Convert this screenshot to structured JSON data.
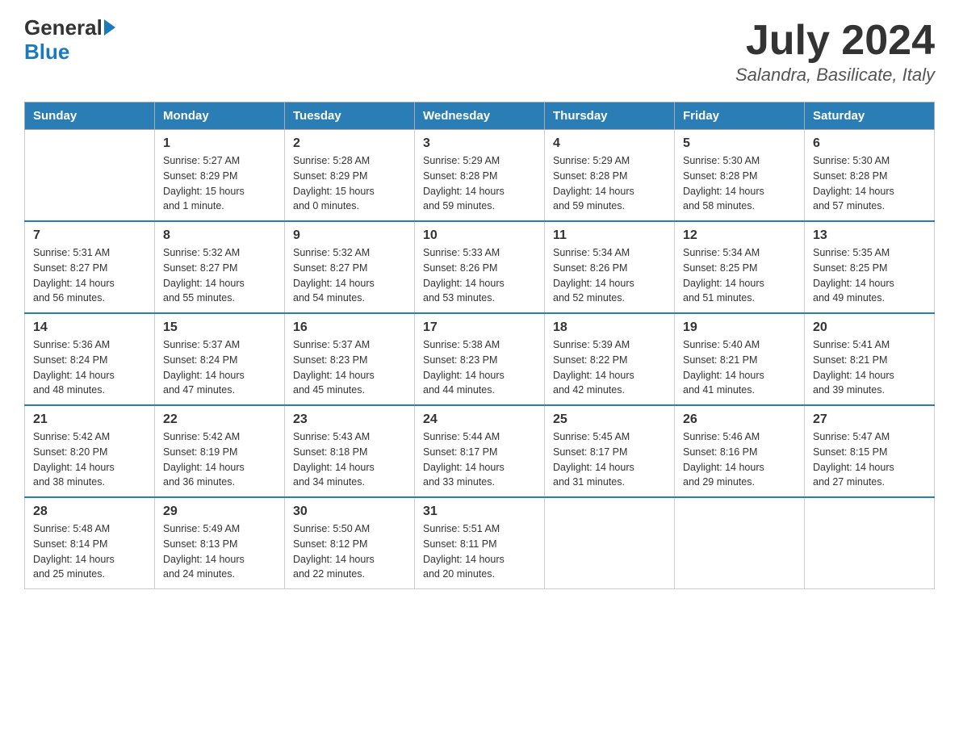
{
  "header": {
    "logo_text1": "General",
    "logo_text2": "Blue",
    "month_title": "July 2024",
    "location": "Salandra, Basilicate, Italy"
  },
  "weekdays": [
    "Sunday",
    "Monday",
    "Tuesday",
    "Wednesday",
    "Thursday",
    "Friday",
    "Saturday"
  ],
  "weeks": [
    [
      {
        "day": "",
        "info": ""
      },
      {
        "day": "1",
        "info": "Sunrise: 5:27 AM\nSunset: 8:29 PM\nDaylight: 15 hours\nand 1 minute."
      },
      {
        "day": "2",
        "info": "Sunrise: 5:28 AM\nSunset: 8:29 PM\nDaylight: 15 hours\nand 0 minutes."
      },
      {
        "day": "3",
        "info": "Sunrise: 5:29 AM\nSunset: 8:28 PM\nDaylight: 14 hours\nand 59 minutes."
      },
      {
        "day": "4",
        "info": "Sunrise: 5:29 AM\nSunset: 8:28 PM\nDaylight: 14 hours\nand 59 minutes."
      },
      {
        "day": "5",
        "info": "Sunrise: 5:30 AM\nSunset: 8:28 PM\nDaylight: 14 hours\nand 58 minutes."
      },
      {
        "day": "6",
        "info": "Sunrise: 5:30 AM\nSunset: 8:28 PM\nDaylight: 14 hours\nand 57 minutes."
      }
    ],
    [
      {
        "day": "7",
        "info": "Sunrise: 5:31 AM\nSunset: 8:27 PM\nDaylight: 14 hours\nand 56 minutes."
      },
      {
        "day": "8",
        "info": "Sunrise: 5:32 AM\nSunset: 8:27 PM\nDaylight: 14 hours\nand 55 minutes."
      },
      {
        "day": "9",
        "info": "Sunrise: 5:32 AM\nSunset: 8:27 PM\nDaylight: 14 hours\nand 54 minutes."
      },
      {
        "day": "10",
        "info": "Sunrise: 5:33 AM\nSunset: 8:26 PM\nDaylight: 14 hours\nand 53 minutes."
      },
      {
        "day": "11",
        "info": "Sunrise: 5:34 AM\nSunset: 8:26 PM\nDaylight: 14 hours\nand 52 minutes."
      },
      {
        "day": "12",
        "info": "Sunrise: 5:34 AM\nSunset: 8:25 PM\nDaylight: 14 hours\nand 51 minutes."
      },
      {
        "day": "13",
        "info": "Sunrise: 5:35 AM\nSunset: 8:25 PM\nDaylight: 14 hours\nand 49 minutes."
      }
    ],
    [
      {
        "day": "14",
        "info": "Sunrise: 5:36 AM\nSunset: 8:24 PM\nDaylight: 14 hours\nand 48 minutes."
      },
      {
        "day": "15",
        "info": "Sunrise: 5:37 AM\nSunset: 8:24 PM\nDaylight: 14 hours\nand 47 minutes."
      },
      {
        "day": "16",
        "info": "Sunrise: 5:37 AM\nSunset: 8:23 PM\nDaylight: 14 hours\nand 45 minutes."
      },
      {
        "day": "17",
        "info": "Sunrise: 5:38 AM\nSunset: 8:23 PM\nDaylight: 14 hours\nand 44 minutes."
      },
      {
        "day": "18",
        "info": "Sunrise: 5:39 AM\nSunset: 8:22 PM\nDaylight: 14 hours\nand 42 minutes."
      },
      {
        "day": "19",
        "info": "Sunrise: 5:40 AM\nSunset: 8:21 PM\nDaylight: 14 hours\nand 41 minutes."
      },
      {
        "day": "20",
        "info": "Sunrise: 5:41 AM\nSunset: 8:21 PM\nDaylight: 14 hours\nand 39 minutes."
      }
    ],
    [
      {
        "day": "21",
        "info": "Sunrise: 5:42 AM\nSunset: 8:20 PM\nDaylight: 14 hours\nand 38 minutes."
      },
      {
        "day": "22",
        "info": "Sunrise: 5:42 AM\nSunset: 8:19 PM\nDaylight: 14 hours\nand 36 minutes."
      },
      {
        "day": "23",
        "info": "Sunrise: 5:43 AM\nSunset: 8:18 PM\nDaylight: 14 hours\nand 34 minutes."
      },
      {
        "day": "24",
        "info": "Sunrise: 5:44 AM\nSunset: 8:17 PM\nDaylight: 14 hours\nand 33 minutes."
      },
      {
        "day": "25",
        "info": "Sunrise: 5:45 AM\nSunset: 8:17 PM\nDaylight: 14 hours\nand 31 minutes."
      },
      {
        "day": "26",
        "info": "Sunrise: 5:46 AM\nSunset: 8:16 PM\nDaylight: 14 hours\nand 29 minutes."
      },
      {
        "day": "27",
        "info": "Sunrise: 5:47 AM\nSunset: 8:15 PM\nDaylight: 14 hours\nand 27 minutes."
      }
    ],
    [
      {
        "day": "28",
        "info": "Sunrise: 5:48 AM\nSunset: 8:14 PM\nDaylight: 14 hours\nand 25 minutes."
      },
      {
        "day": "29",
        "info": "Sunrise: 5:49 AM\nSunset: 8:13 PM\nDaylight: 14 hours\nand 24 minutes."
      },
      {
        "day": "30",
        "info": "Sunrise: 5:50 AM\nSunset: 8:12 PM\nDaylight: 14 hours\nand 22 minutes."
      },
      {
        "day": "31",
        "info": "Sunrise: 5:51 AM\nSunset: 8:11 PM\nDaylight: 14 hours\nand 20 minutes."
      },
      {
        "day": "",
        "info": ""
      },
      {
        "day": "",
        "info": ""
      },
      {
        "day": "",
        "info": ""
      }
    ]
  ]
}
